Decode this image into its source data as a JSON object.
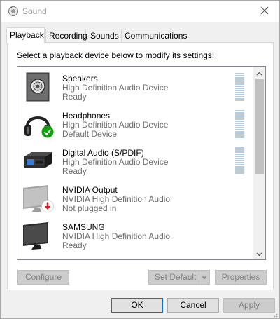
{
  "window": {
    "title": "Sound",
    "icons": {
      "app": "speaker-app-icon",
      "close": "close-icon"
    }
  },
  "tabs": [
    {
      "label": "Playback",
      "selected": true
    },
    {
      "label": "Recording",
      "selected": false
    },
    {
      "label": "Sounds",
      "selected": false
    },
    {
      "label": "Communications",
      "selected": false
    }
  ],
  "playback": {
    "instruction": "Select a playback device below to modify its settings:",
    "devices": [
      {
        "name": "Speakers",
        "description": "High Definition Audio Device",
        "status": "Ready",
        "icon": "speaker-icon",
        "badge": null
      },
      {
        "name": "Headphones",
        "description": "High Definition Audio Device",
        "status": "Default Device",
        "icon": "headphones-icon",
        "badge": "default-check-badge"
      },
      {
        "name": "Digital Audio (S/PDIF)",
        "description": "High Definition Audio Device",
        "status": "Ready",
        "icon": "digital-audio-icon",
        "badge": null
      },
      {
        "name": "NVIDIA Output",
        "description": "NVIDIA High Definition Audio",
        "status": "Not plugged in",
        "icon": "monitor-icon",
        "badge": "unplugged-arrow-badge"
      },
      {
        "name": "SAMSUNG",
        "description": "NVIDIA High Definition Audio",
        "status": "Ready",
        "icon": "monitor-icon",
        "badge": null
      }
    ],
    "buttons": {
      "configure": "Configure",
      "set_default": "Set Default",
      "properties": "Properties"
    }
  },
  "footer": {
    "ok": "OK",
    "cancel": "Cancel",
    "apply": "Apply"
  },
  "colors": {
    "accent": "#0078d7",
    "meter": "#b7ccdd",
    "default_badge": "#13a10e",
    "unplugged_badge": "#d21f1f",
    "secondary_text": "#6d6d6d"
  }
}
